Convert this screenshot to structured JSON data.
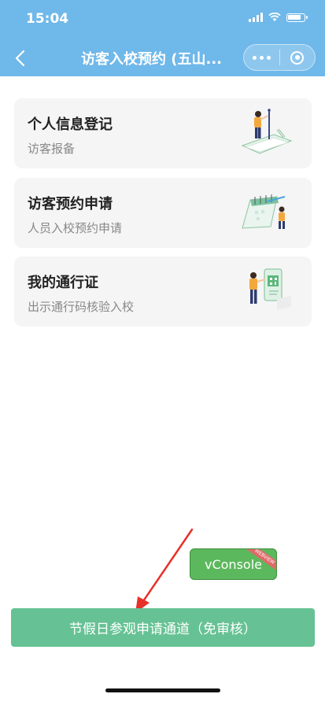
{
  "status_bar": {
    "time": "15:04"
  },
  "nav": {
    "title": "访客入校预约 (五山..."
  },
  "cards": [
    {
      "title": "个人信息登记",
      "subtitle": "访客报备",
      "icon": "person-with-board-icon"
    },
    {
      "title": "访客预约申请",
      "subtitle": "人员入校预约申请",
      "icon": "calendar-person-icon"
    },
    {
      "title": "我的通行证",
      "subtitle": "出示通行码核验入校",
      "icon": "qr-pass-person-icon"
    }
  ],
  "vconsole": {
    "label": "vConsole",
    "ribbon": "WEBVIEW"
  },
  "holiday_button": {
    "label": "节假日参观申请通道（免审核）"
  },
  "colors": {
    "header": "#6fb8ea",
    "primary_button": "#66c294",
    "vconsole": "#5cb85c",
    "arrow": "#e8302a"
  }
}
